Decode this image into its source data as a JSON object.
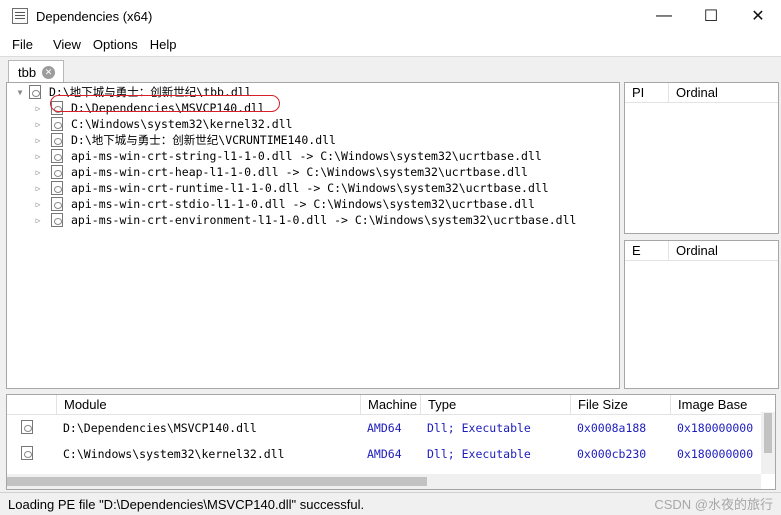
{
  "window": {
    "title": "Dependencies (x64)",
    "min_glyph": "—",
    "max_glyph": "☐",
    "close_glyph": "✕"
  },
  "menu": [
    "File",
    "View",
    "Options",
    "Help"
  ],
  "tab": {
    "label": "tbb",
    "close_glyph": "✕"
  },
  "tree": {
    "root": "D:\\地下城与勇士：创新世纪\\tbb.dll",
    "children": [
      "D:\\Dependencies\\MSVCP140.dll",
      "C:\\Windows\\system32\\kernel32.dll",
      "D:\\地下城与勇士：创新世纪\\VCRUNTIME140.dll",
      "api-ms-win-crt-string-l1-1-0.dll -> C:\\Windows\\system32\\ucrtbase.dll",
      "api-ms-win-crt-heap-l1-1-0.dll -> C:\\Windows\\system32\\ucrtbase.dll",
      "api-ms-win-crt-runtime-l1-1-0.dll -> C:\\Windows\\system32\\ucrtbase.dll",
      "api-ms-win-crt-stdio-l1-1-0.dll -> C:\\Windows\\system32\\ucrtbase.dll",
      "api-ms-win-crt-environment-l1-1-0.dll -> C:\\Windows\\system32\\ucrtbase.dll"
    ]
  },
  "imports_panel": {
    "col1": "PI",
    "col2": "Ordinal"
  },
  "exports_panel": {
    "col1": "E",
    "col2": "Ordinal"
  },
  "modules": {
    "headers": [
      "Module",
      "Machine",
      "Type",
      "File Size",
      "Image Base"
    ],
    "rows": [
      [
        "D:\\Dependencies\\MSVCP140.dll",
        "AMD64",
        "Dll; Executable",
        "0x0008a188",
        "0x180000000"
      ],
      [
        "C:\\Windows\\system32\\kernel32.dll",
        "AMD64",
        "Dll; Executable",
        "0x000cb230",
        "0x180000000"
      ]
    ]
  },
  "status": "Loading PE file \"D:\\Dependencies\\MSVCP140.dll\" successful.",
  "watermark": "CSDN @水夜的旅行"
}
